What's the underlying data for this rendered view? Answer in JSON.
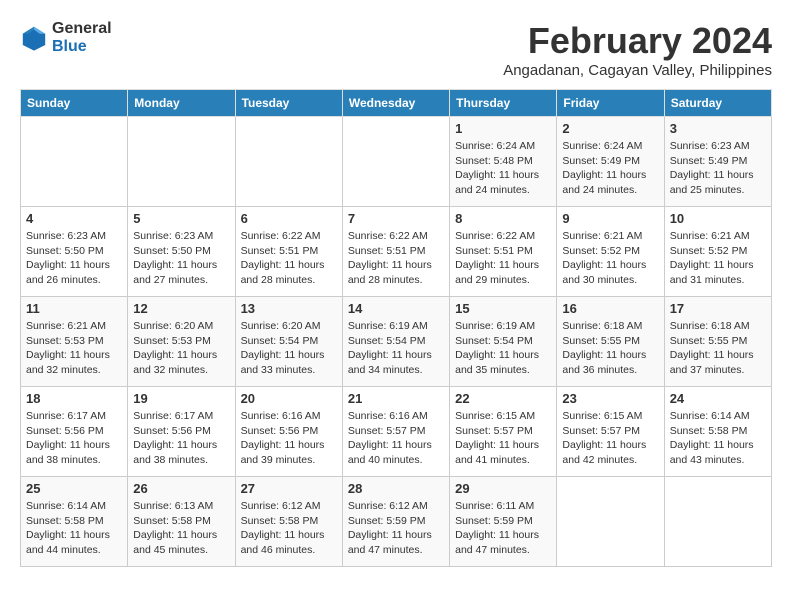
{
  "logo": {
    "line1": "General",
    "line2": "Blue"
  },
  "title": "February 2024",
  "subtitle": "Angadanan, Cagayan Valley, Philippines",
  "headers": [
    "Sunday",
    "Monday",
    "Tuesday",
    "Wednesday",
    "Thursday",
    "Friday",
    "Saturday"
  ],
  "weeks": [
    [
      {
        "day": "",
        "detail": ""
      },
      {
        "day": "",
        "detail": ""
      },
      {
        "day": "",
        "detail": ""
      },
      {
        "day": "",
        "detail": ""
      },
      {
        "day": "1",
        "detail": "Sunrise: 6:24 AM\nSunset: 5:48 PM\nDaylight: 11 hours\nand 24 minutes."
      },
      {
        "day": "2",
        "detail": "Sunrise: 6:24 AM\nSunset: 5:49 PM\nDaylight: 11 hours\nand 24 minutes."
      },
      {
        "day": "3",
        "detail": "Sunrise: 6:23 AM\nSunset: 5:49 PM\nDaylight: 11 hours\nand 25 minutes."
      }
    ],
    [
      {
        "day": "4",
        "detail": "Sunrise: 6:23 AM\nSunset: 5:50 PM\nDaylight: 11 hours\nand 26 minutes."
      },
      {
        "day": "5",
        "detail": "Sunrise: 6:23 AM\nSunset: 5:50 PM\nDaylight: 11 hours\nand 27 minutes."
      },
      {
        "day": "6",
        "detail": "Sunrise: 6:22 AM\nSunset: 5:51 PM\nDaylight: 11 hours\nand 28 minutes."
      },
      {
        "day": "7",
        "detail": "Sunrise: 6:22 AM\nSunset: 5:51 PM\nDaylight: 11 hours\nand 28 minutes."
      },
      {
        "day": "8",
        "detail": "Sunrise: 6:22 AM\nSunset: 5:51 PM\nDaylight: 11 hours\nand 29 minutes."
      },
      {
        "day": "9",
        "detail": "Sunrise: 6:21 AM\nSunset: 5:52 PM\nDaylight: 11 hours\nand 30 minutes."
      },
      {
        "day": "10",
        "detail": "Sunrise: 6:21 AM\nSunset: 5:52 PM\nDaylight: 11 hours\nand 31 minutes."
      }
    ],
    [
      {
        "day": "11",
        "detail": "Sunrise: 6:21 AM\nSunset: 5:53 PM\nDaylight: 11 hours\nand 32 minutes."
      },
      {
        "day": "12",
        "detail": "Sunrise: 6:20 AM\nSunset: 5:53 PM\nDaylight: 11 hours\nand 32 minutes."
      },
      {
        "day": "13",
        "detail": "Sunrise: 6:20 AM\nSunset: 5:54 PM\nDaylight: 11 hours\nand 33 minutes."
      },
      {
        "day": "14",
        "detail": "Sunrise: 6:19 AM\nSunset: 5:54 PM\nDaylight: 11 hours\nand 34 minutes."
      },
      {
        "day": "15",
        "detail": "Sunrise: 6:19 AM\nSunset: 5:54 PM\nDaylight: 11 hours\nand 35 minutes."
      },
      {
        "day": "16",
        "detail": "Sunrise: 6:18 AM\nSunset: 5:55 PM\nDaylight: 11 hours\nand 36 minutes."
      },
      {
        "day": "17",
        "detail": "Sunrise: 6:18 AM\nSunset: 5:55 PM\nDaylight: 11 hours\nand 37 minutes."
      }
    ],
    [
      {
        "day": "18",
        "detail": "Sunrise: 6:17 AM\nSunset: 5:56 PM\nDaylight: 11 hours\nand 38 minutes."
      },
      {
        "day": "19",
        "detail": "Sunrise: 6:17 AM\nSunset: 5:56 PM\nDaylight: 11 hours\nand 38 minutes."
      },
      {
        "day": "20",
        "detail": "Sunrise: 6:16 AM\nSunset: 5:56 PM\nDaylight: 11 hours\nand 39 minutes."
      },
      {
        "day": "21",
        "detail": "Sunrise: 6:16 AM\nSunset: 5:57 PM\nDaylight: 11 hours\nand 40 minutes."
      },
      {
        "day": "22",
        "detail": "Sunrise: 6:15 AM\nSunset: 5:57 PM\nDaylight: 11 hours\nand 41 minutes."
      },
      {
        "day": "23",
        "detail": "Sunrise: 6:15 AM\nSunset: 5:57 PM\nDaylight: 11 hours\nand 42 minutes."
      },
      {
        "day": "24",
        "detail": "Sunrise: 6:14 AM\nSunset: 5:58 PM\nDaylight: 11 hours\nand 43 minutes."
      }
    ],
    [
      {
        "day": "25",
        "detail": "Sunrise: 6:14 AM\nSunset: 5:58 PM\nDaylight: 11 hours\nand 44 minutes."
      },
      {
        "day": "26",
        "detail": "Sunrise: 6:13 AM\nSunset: 5:58 PM\nDaylight: 11 hours\nand 45 minutes."
      },
      {
        "day": "27",
        "detail": "Sunrise: 6:12 AM\nSunset: 5:58 PM\nDaylight: 11 hours\nand 46 minutes."
      },
      {
        "day": "28",
        "detail": "Sunrise: 6:12 AM\nSunset: 5:59 PM\nDaylight: 11 hours\nand 47 minutes."
      },
      {
        "day": "29",
        "detail": "Sunrise: 6:11 AM\nSunset: 5:59 PM\nDaylight: 11 hours\nand 47 minutes."
      },
      {
        "day": "",
        "detail": ""
      },
      {
        "day": "",
        "detail": ""
      }
    ]
  ]
}
